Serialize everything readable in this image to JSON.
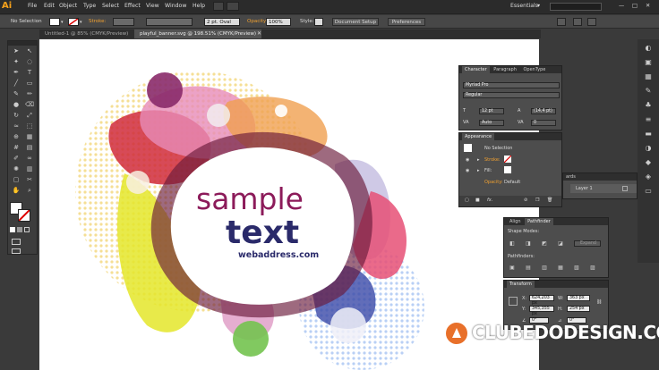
{
  "menubar": {
    "logo": "Ai",
    "items": [
      "File",
      "Edit",
      "Object",
      "Type",
      "Select",
      "Effect",
      "View",
      "Window",
      "Help"
    ],
    "workspace": "Essentials"
  },
  "control": {
    "selection": "No Selection",
    "stroke_label": "Stroke:",
    "stroke_size": "2 pt. Oval",
    "opacity_label": "Opacity:",
    "opacity": "100%",
    "style_label": "Style:",
    "doc_setup": "Document Setup",
    "preferences": "Preferences"
  },
  "tabs": [
    "Untitled-1 @ 85% (CMYK/Preview)",
    "playful_banner.svg @ 198.51% (CMYK/Preview)"
  ],
  "artwork": {
    "line1": "sample",
    "line2": "text",
    "line3": "webaddress.com",
    "color1": "#8c1b5a",
    "color2": "#2a2a6a"
  },
  "character": {
    "tabs": [
      "Character",
      "Paragraph",
      "OpenType"
    ],
    "font": "Myriad Pro",
    "style": "Regular",
    "size": "12 pt",
    "leading": "(14,4 pt)",
    "kerning": "Auto",
    "tracking": "0"
  },
  "appearance": {
    "title": "Appearance",
    "header": "No Selection",
    "stroke": "Stroke:",
    "fill": "Fill:",
    "opacity": "Opacity:",
    "opacity_value": "Default"
  },
  "layers": {
    "tab": "ards",
    "layer": "Layer 1"
  },
  "pathfinder": {
    "tabs": [
      "Align",
      "Pathfinder"
    ],
    "shape_modes": "Shape Modes:",
    "expand": "Expand",
    "pathfinders": "Pathfinders:"
  },
  "transform": {
    "title": "Transform",
    "x": "624,203 px",
    "y": "345,355 px",
    "w": "363 px",
    "h": "254 px",
    "angle": "0°",
    "shear": "0°"
  },
  "watermark": "CLUBEDODESIGN.COM"
}
